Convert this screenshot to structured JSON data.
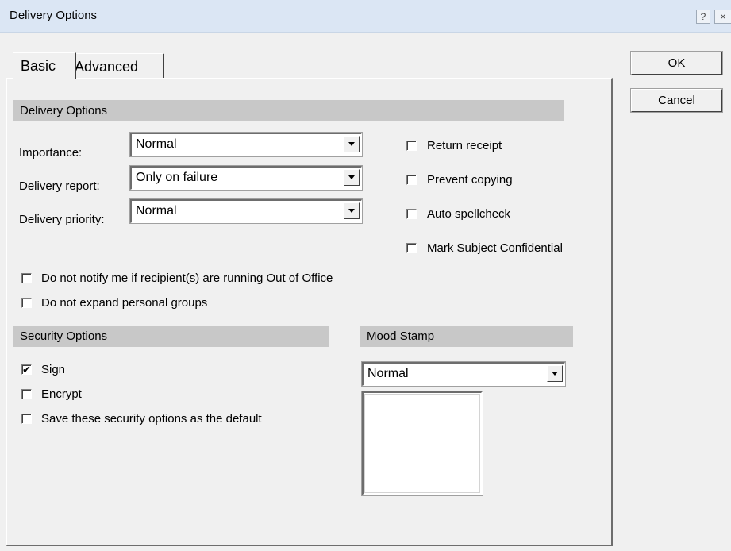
{
  "window": {
    "title": "Delivery Options",
    "help_glyph": "?",
    "close_glyph": "×"
  },
  "tabs": [
    {
      "label": "Basic",
      "selected": true
    },
    {
      "label": "Advanced",
      "selected": false
    }
  ],
  "delivery": {
    "header": "Delivery Options",
    "importance_label": "Importance:",
    "importance_value": "Normal",
    "report_label": "Delivery report:",
    "report_value": "Only on failure",
    "priority_label": "Delivery priority:",
    "priority_value": "Normal",
    "return_receipt": {
      "label": "Return receipt",
      "checked": false
    },
    "prevent_copying": {
      "label": "Prevent copying",
      "checked": false
    },
    "auto_spellcheck": {
      "label": "Auto spellcheck",
      "checked": false
    },
    "mark_confidential": {
      "label": "Mark Subject Confidential",
      "checked": false
    },
    "no_oof_notify": {
      "label": "Do not notify me if recipient(s) are running Out of Office",
      "checked": false
    },
    "no_expand_groups": {
      "label": "Do not expand personal groups",
      "checked": false
    }
  },
  "security": {
    "header": "Security Options",
    "sign": {
      "label": "Sign",
      "checked": true,
      "mark": "✔"
    },
    "encrypt": {
      "label": "Encrypt",
      "checked": false
    },
    "save_default": {
      "label": "Save these security options as the default",
      "checked": false
    }
  },
  "mood": {
    "header": "Mood Stamp",
    "value": "Normal"
  },
  "buttons": {
    "ok": "OK",
    "cancel": "Cancel"
  }
}
